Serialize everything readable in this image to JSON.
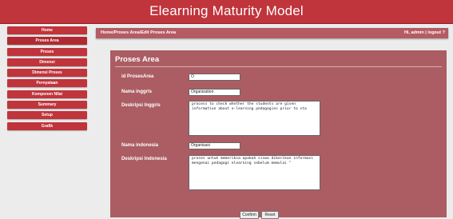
{
  "app": {
    "title": "Elearning Maturity Model"
  },
  "sidebar": {
    "items": [
      {
        "label": "Home"
      },
      {
        "label": "Proses Area"
      },
      {
        "label": "Proses"
      },
      {
        "label": "Dimensi"
      },
      {
        "label": "Dimensi Proses"
      },
      {
        "label": "Pernyataan"
      },
      {
        "label": "Komponen Nilai"
      },
      {
        "label": "Summary"
      },
      {
        "label": "Setup"
      },
      {
        "label": "Grafik"
      }
    ]
  },
  "breadcrumb": {
    "home": "Home",
    "sep1": "/",
    "section": "Proses Area",
    "sep2": "/",
    "current": "Edit Proses Area"
  },
  "user": {
    "greeting": "Hi, admin",
    "sep": "|",
    "logout": "logout ?"
  },
  "form": {
    "heading": "Proses Area",
    "id_label": "id ProsesArea",
    "id_value": "O",
    "nama_inggris_label": "Nama inggris",
    "nama_inggris_value": "Organization",
    "deskripsi_inggris_label": "Deskripsi Inggris",
    "deskripsi_inggris_value": "process to check whether the students are given information about e-learning pedagogies prior to sta",
    "nama_indonesia_label": "Nama indonesia",
    "nama_indonesia_value": "Organisasi",
    "deskripsi_indonesia_label": "Deskripsi Indonesia",
    "deskripsi_indonesia_value": "proses untuk memeriksa apakah siswa diberikan informasi mengenai pedagogi elearning sebelum memulai \"",
    "confirm_label": "Confirm",
    "reset_label": "Reset"
  },
  "colors": {
    "header": "#c0343b",
    "panel": "#ab5d63",
    "crumbbar": "#b45b63",
    "background": "#ececec"
  }
}
